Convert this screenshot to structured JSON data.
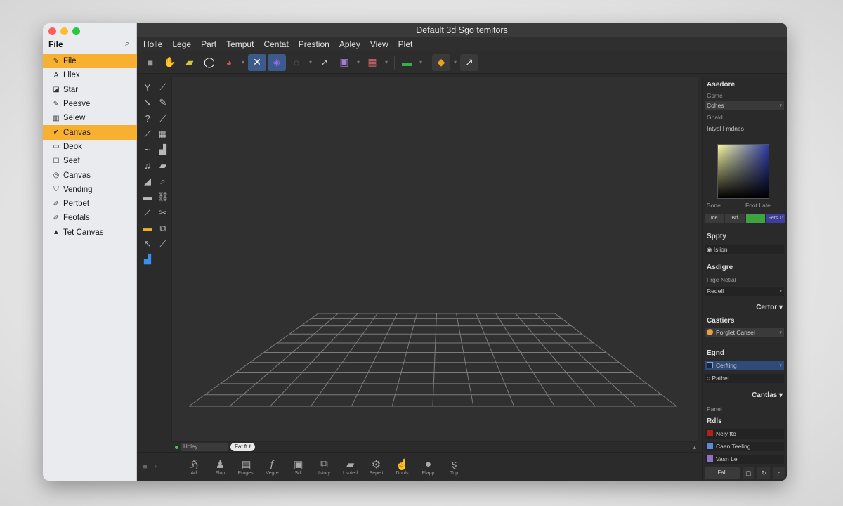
{
  "window": {
    "title": "Default 3d Sgo temitors"
  },
  "sidebar": {
    "title": "File",
    "items": [
      {
        "icon": "✎",
        "label": "File",
        "active": true
      },
      {
        "icon": "A",
        "label": "Lllex",
        "active": false
      },
      {
        "icon": "◪",
        "label": "Star",
        "active": false
      },
      {
        "icon": "✎",
        "label": "Peesve",
        "active": false
      },
      {
        "icon": "▥",
        "label": "Selew",
        "active": false
      },
      {
        "icon": "✔",
        "label": "Canvas",
        "active": true
      },
      {
        "icon": "▭",
        "label": "Deok",
        "active": false
      },
      {
        "icon": "☐",
        "label": "Seef",
        "active": false
      },
      {
        "icon": "◎",
        "label": "Canvas",
        "active": false
      },
      {
        "icon": "⛉",
        "label": "Vending",
        "active": false
      },
      {
        "icon": "✐",
        "label": "Pertbet",
        "active": false
      },
      {
        "icon": "✐",
        "label": "Feotals",
        "active": false
      },
      {
        "icon": "▲",
        "label": "Tet Canvas",
        "active": false
      }
    ]
  },
  "menu": [
    "Holle",
    "Lege",
    "Part",
    "Temput",
    "Centat",
    "Prestion",
    "Apley",
    "View",
    "Plet"
  ],
  "canvas_footer": {
    "select": "Holey",
    "pill": "Fat ft ℓ",
    "end": "▴"
  },
  "dock": [
    {
      "label": "Adl"
    },
    {
      "label": "Flop"
    },
    {
      "label": "Progest"
    },
    {
      "label": "Vegre"
    },
    {
      "label": "Sdl"
    },
    {
      "label": "Istory"
    },
    {
      "label": "Lsoted"
    },
    {
      "label": "Sepeit"
    },
    {
      "label": "Dools"
    },
    {
      "label": "Plapp"
    },
    {
      "label": "Top"
    }
  ],
  "panel": {
    "head1": "Asedore",
    "label_field": "Gsme",
    "field1": "Cohes",
    "label_field2": "Gnald",
    "field2": "Intyol I mdnes",
    "swatch_labels": [
      "Sone",
      "Foot Late"
    ],
    "swatches": [
      "Ide",
      "Brf",
      "Fets Tf"
    ],
    "s_head": "Sppty",
    "s_field": "Islion",
    "a_head": "Asdigre",
    "a_label": "Frge Netial",
    "a_field": "Redell",
    "right1": "Certor ▾",
    "c_head": "Castiers",
    "c_field": "Porglet Cansel",
    "e_head": "Egnd",
    "e_field1": "Cerfting",
    "e_field2": "Patbel",
    "right2": "Cantlas ▾",
    "p_label": "Panel",
    "r_head": "Rdls",
    "r_items": [
      "Nely fto",
      "Caen Teeling",
      "Vasn Le"
    ],
    "bottom_btn": "Fall"
  }
}
